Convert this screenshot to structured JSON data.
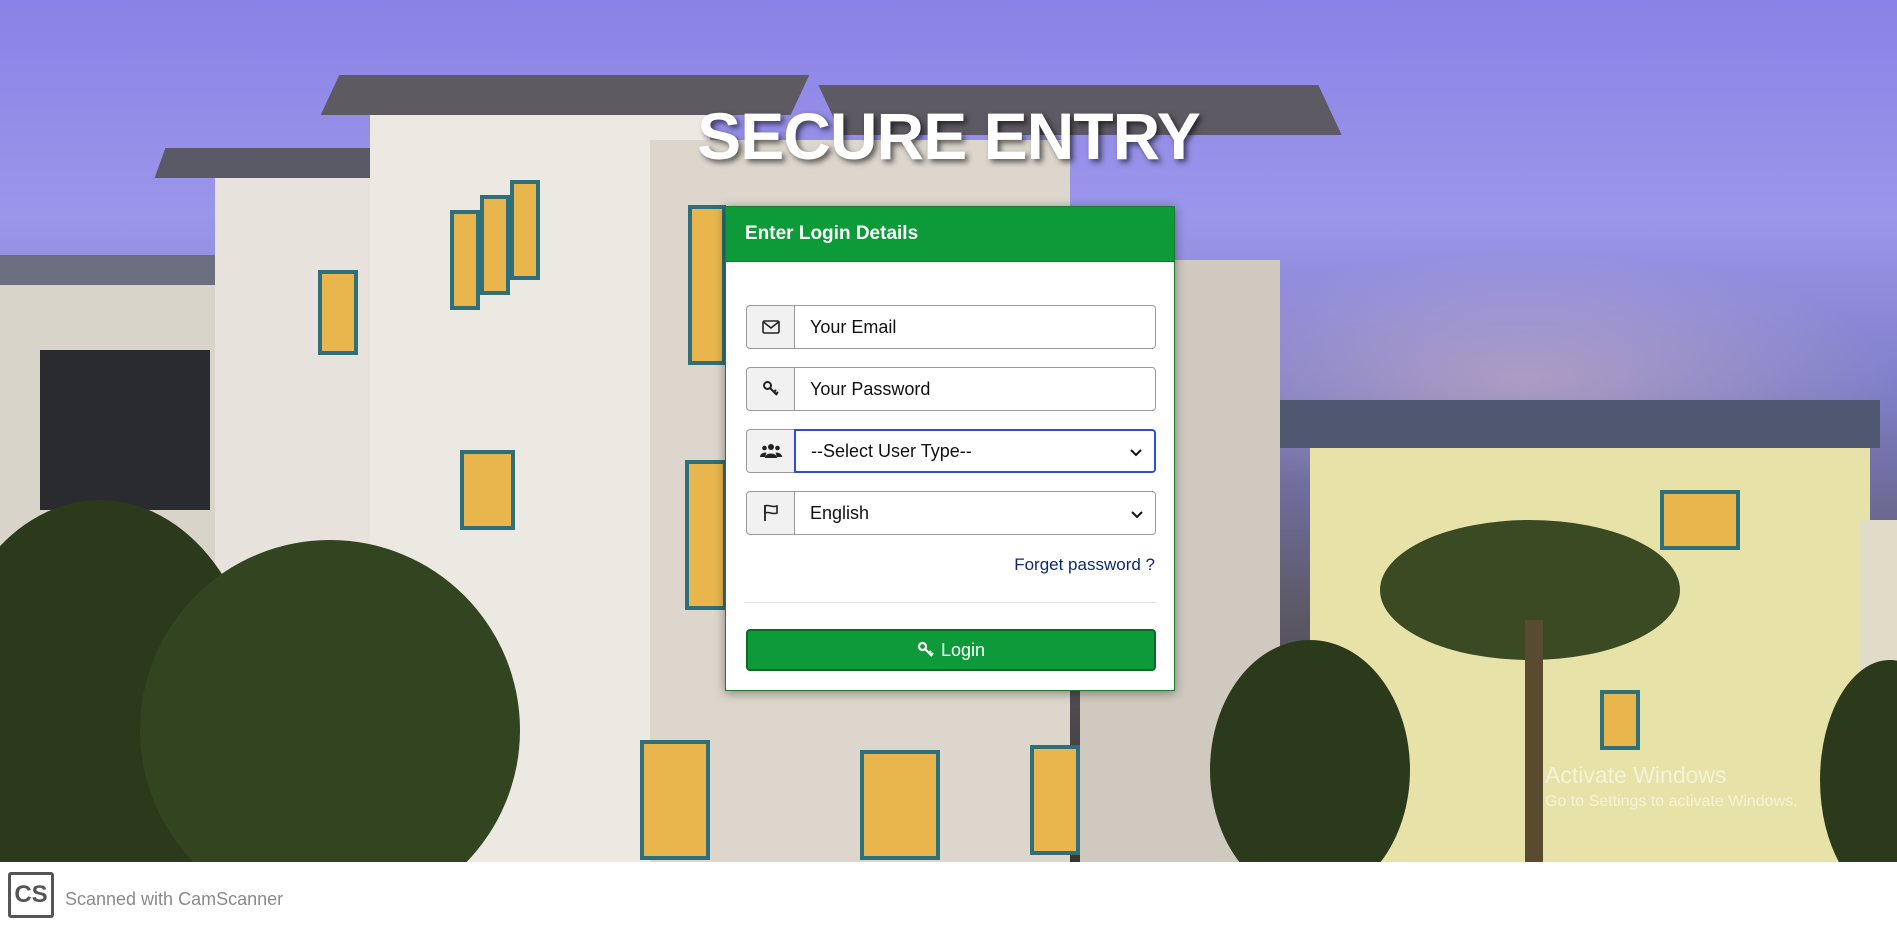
{
  "page": {
    "title": "SECURE ENTRY"
  },
  "login_card": {
    "heading": "Enter Login Details",
    "email_placeholder": "Your Email",
    "password_placeholder": "Your Password",
    "user_type_selected": "--Select User Type--",
    "language_selected": "English",
    "forgot_link": "Forget password ?",
    "login_label": "Login"
  },
  "icons": {
    "email": "envelope-icon",
    "password": "key-icon",
    "user_type": "users-icon",
    "language": "flag-icon",
    "login": "key-icon"
  },
  "colors": {
    "accent": "#0d9a38",
    "link": "#0b2a6f",
    "focus": "#2d4ed8"
  },
  "watermark": {
    "line1": "Activate Windows",
    "line2": "Go to Settings to activate Windows."
  },
  "footer": {
    "logo_text": "CS",
    "scanner_text": "Scanned with CamScanner"
  }
}
